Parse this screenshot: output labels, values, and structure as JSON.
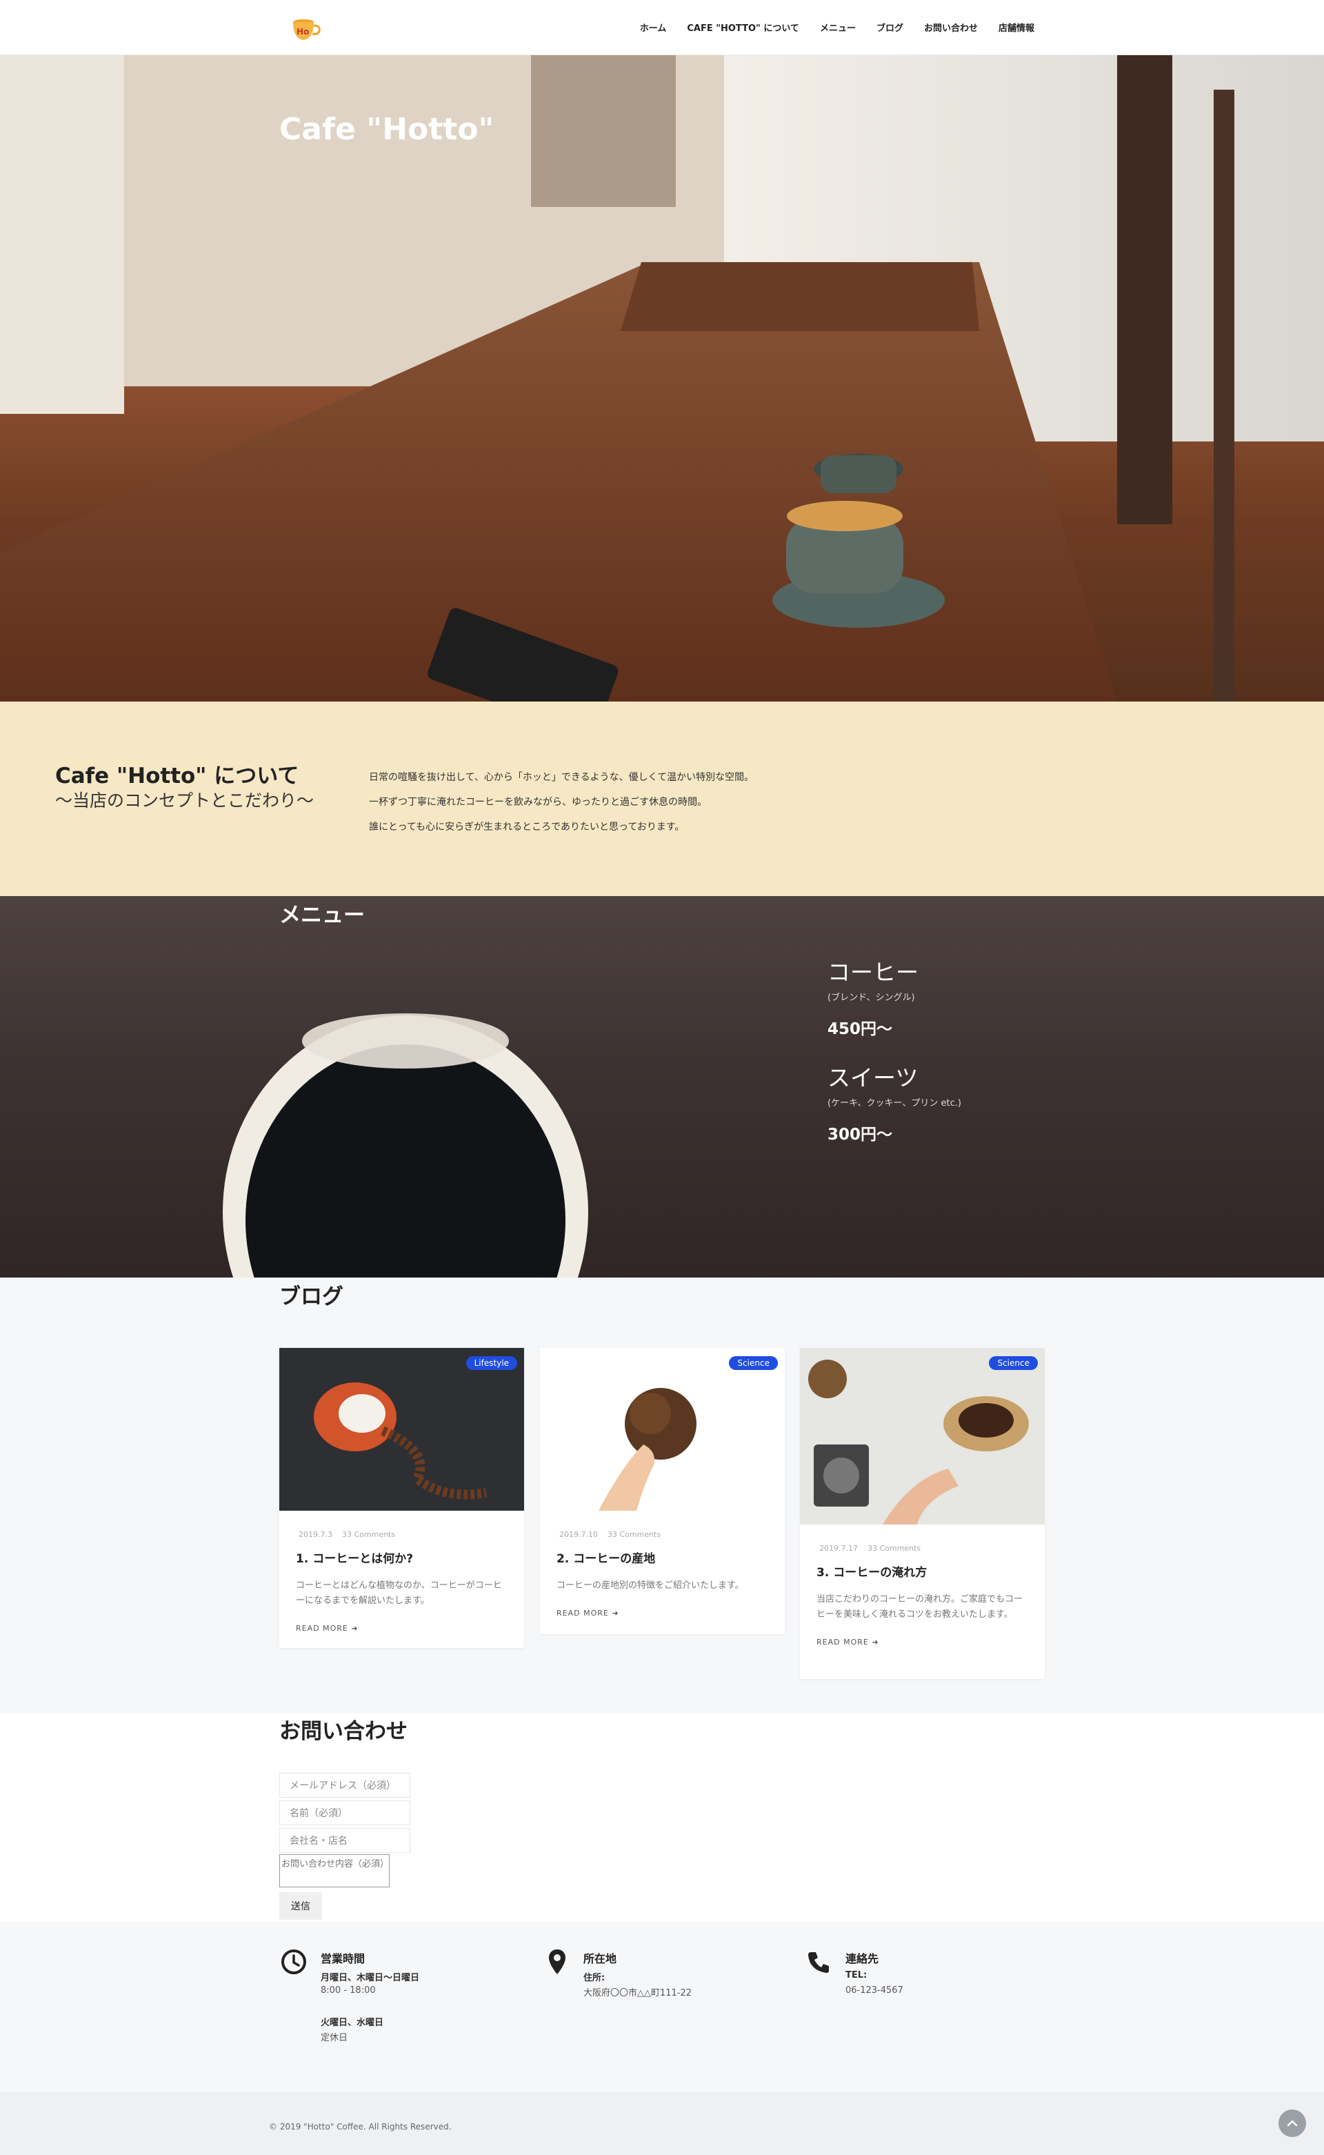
{
  "header": {
    "logo_text": "Ho",
    "nav": [
      "ホーム",
      "CAFE \"HOTTO\" について",
      "メニュー",
      "ブログ",
      "お問い合わせ",
      "店舗情報"
    ]
  },
  "hero": {
    "title": "Cafe \"Hotto\""
  },
  "about": {
    "title": "Cafe \"Hotto\" について",
    "subtitle": "〜当店のコンセプトとこだわり〜",
    "lines": [
      "日常の喧騒を抜け出して、心から「ホッと」できるような、優しくて温かい特別な空間。",
      "一杯ずつ丁寧に淹れたコーヒーを飲みながら、ゆったりと過ごす休息の時間。",
      "誰にとっても心に安らぎが生まれるところでありたいと思っております。"
    ]
  },
  "menu": {
    "title": "メニュー",
    "items": [
      {
        "name": "コーヒー",
        "desc": "(ブレンド、シングル)",
        "price": "450円〜"
      },
      {
        "name": "スイーツ",
        "desc": "(ケーキ、クッキー、プリン etc.)",
        "price": "300円〜"
      }
    ]
  },
  "blog": {
    "title": "ブログ",
    "read_more": "READ MORE",
    "posts": [
      {
        "tag": "Lifestyle",
        "date": "2019.7.3",
        "comments": "33 Comments",
        "title": "1. コーヒーとは何か?",
        "excerpt": "コーヒーとはどんな植物なのか、コーヒーがコーヒーになるまでを解説いたします。"
      },
      {
        "tag": "Science",
        "date": "2019.7.10",
        "comments": "33 Comments",
        "title": "2. コーヒーの産地",
        "excerpt": "コーヒーの産地別の特徴をご紹介いたします。"
      },
      {
        "tag": "Science",
        "date": "2019.7.17",
        "comments": "33 Comments",
        "title": "3. コーヒーの淹れ方",
        "excerpt": "当店こだわりのコーヒーの淹れ方。ご家庭でもコーヒーを美味しく淹れるコツをお教えいたします。"
      }
    ]
  },
  "contact": {
    "title": "お問い合わせ",
    "email_placeholder": "メールアドレス（必須）",
    "name_placeholder": "名前（必須）",
    "company_placeholder": "会社名・店名",
    "message_placeholder": "お問い合わせ内容（必須）",
    "submit": "送信"
  },
  "info": {
    "hours": {
      "title": "営業時間",
      "days1": "月曜日、木曜日〜日曜日",
      "time1": "8:00 - 18:00",
      "days2": "火曜日、水曜日",
      "closed": "定休日"
    },
    "location": {
      "title": "所在地",
      "label": "住所:",
      "address": "大阪府〇〇市△△町111-22"
    },
    "contact": {
      "title": "連絡先",
      "label": "TEL:",
      "phone": "06-123-4567"
    }
  },
  "footer": {
    "copyright": "© 2019 \"Hotto\" Coffee. All Rights Reserved."
  },
  "colors": {
    "accent": "#1e4de0",
    "about_bg": "#f7e8c5",
    "logo_orange": "#f4a32a"
  }
}
